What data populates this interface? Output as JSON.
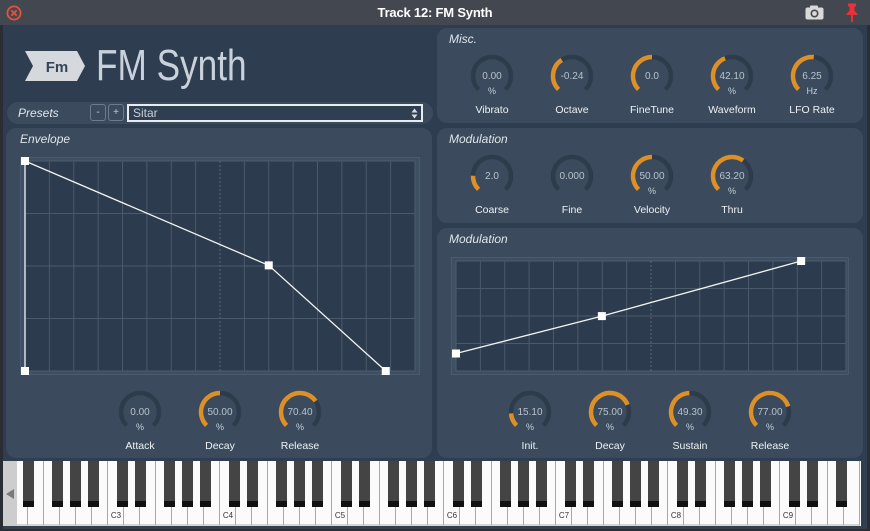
{
  "window": {
    "title": "Track 12: FM Synth"
  },
  "header": {
    "badge": "Fm",
    "title": "FM Synth"
  },
  "presets": {
    "label": "Presets",
    "minus_label": "-",
    "plus_label": "+",
    "selected": "Sitar"
  },
  "envelope": {
    "title": "Envelope",
    "points": [
      [
        0,
        0
      ],
      [
        0,
        1
      ],
      [
        0.625,
        0.503
      ],
      [
        0.925,
        0
      ]
    ],
    "knobs": [
      {
        "label": "Attack",
        "value": "0.00",
        "unit": "%",
        "fill": 0
      },
      {
        "label": "Decay",
        "value": "50.00",
        "unit": "%",
        "fill": 0.5
      },
      {
        "label": "Release",
        "value": "70.40",
        "unit": "%",
        "fill": 0.704
      }
    ]
  },
  "misc": {
    "title": "Misc.",
    "knobs": [
      {
        "label": "Vibrato",
        "value": "0.00",
        "unit": "%",
        "fill": 0
      },
      {
        "label": "Octave",
        "value": "-0.24",
        "unit": "",
        "fill": 0.38
      },
      {
        "label": "FineTune",
        "value": "0.0",
        "unit": "",
        "fill": 0.5
      },
      {
        "label": "Waveform",
        "value": "42.10",
        "unit": "%",
        "fill": 0.421
      },
      {
        "label": "LFO Rate",
        "value": "6.25",
        "unit": "Hz",
        "fill": 0.52
      }
    ]
  },
  "modulation": {
    "title": "Modulation",
    "knobs": [
      {
        "label": "Coarse",
        "value": "2.0",
        "unit": "",
        "fill": 0.17
      },
      {
        "label": "Fine",
        "value": "0.000",
        "unit": "",
        "fill": 0
      },
      {
        "label": "Velocity",
        "value": "50.00",
        "unit": "%",
        "fill": 0.5
      },
      {
        "label": "Thru",
        "value": "63.20",
        "unit": "%",
        "fill": 0.632
      }
    ]
  },
  "modulation_env": {
    "title": "Modulation",
    "points": [
      [
        0,
        0.159
      ],
      [
        0.374,
        0.499
      ],
      [
        0.885,
        1
      ]
    ],
    "knobs": [
      {
        "label": "Init.",
        "value": "15.10",
        "unit": "%",
        "fill": 0.151
      },
      {
        "label": "Decay",
        "value": "75.00",
        "unit": "%",
        "fill": 0.75
      },
      {
        "label": "Sustain",
        "value": "49.30",
        "unit": "%",
        "fill": 0.493
      },
      {
        "label": "Release",
        "value": "77.00",
        "unit": "%",
        "fill": 0.77
      }
    ]
  },
  "keyboard": {
    "first_visible": "D2",
    "last_visible": "G9",
    "labels": [
      "C3",
      "C4",
      "C5",
      "C6",
      "C7",
      "C8",
      "C9"
    ]
  },
  "icons": {
    "close": "close-icon",
    "camera": "camera-icon",
    "pin": "pin-icon",
    "scroll_left": "scroll-left-icon",
    "select_arrows": "select-arrows-icon"
  },
  "colors": {
    "accent": "#dc9027",
    "close": "#e4533f",
    "pin": "#e8313a"
  }
}
